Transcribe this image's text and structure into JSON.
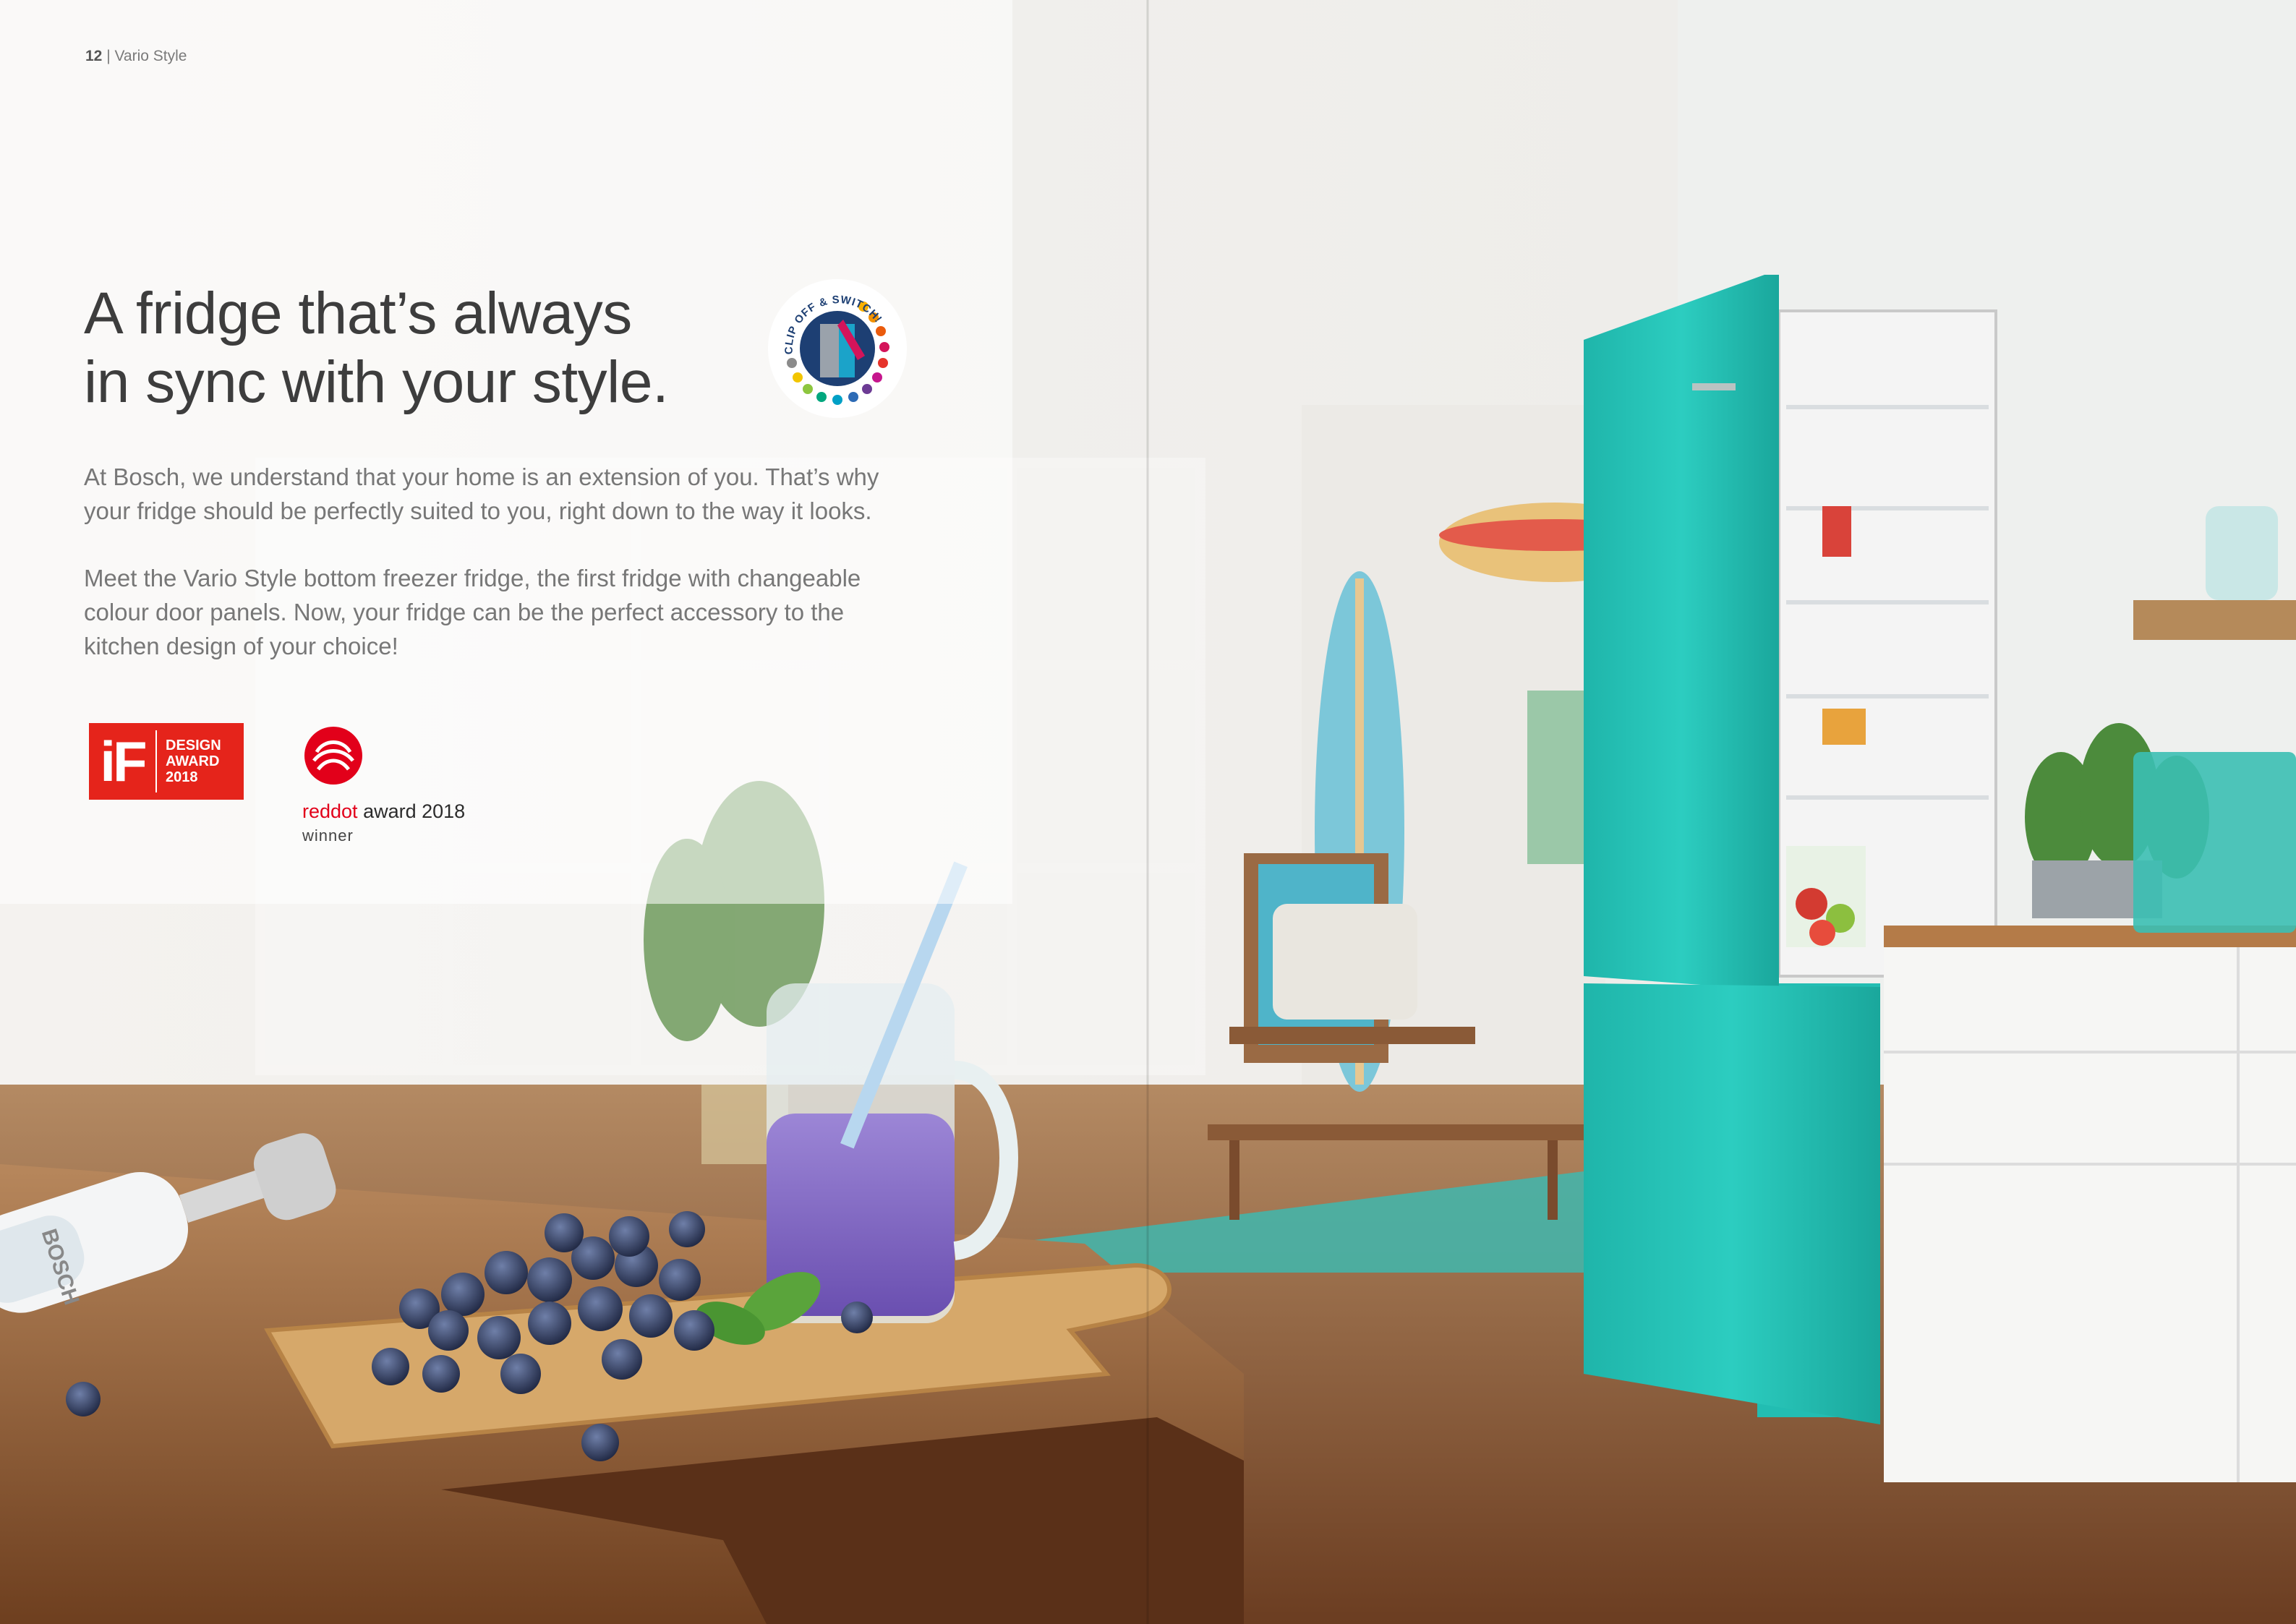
{
  "page": {
    "number": "12",
    "section": "Vario Style"
  },
  "headline": {
    "line1": "A fridge that’s always",
    "line2": "in sync with your style."
  },
  "body": {
    "p1_line1": "At Bosch, we understand that your home is an extension of you. That’s why",
    "p1_line2": "your fridge should be perfectly suited to you, right down to the way it looks.",
    "p2_line1": "Meet the Vario Style bottom freezer fridge, the first fridge with changeable",
    "p2_line2": "colour door panels. Now, your fridge can be the perfect accessory to the",
    "p2_line3": "kitchen design of your choice!"
  },
  "awards": {
    "if": {
      "logo": "iF",
      "line1": "DESIGN",
      "line2": "AWARD",
      "line3": "2018",
      "color": "#e5241b"
    },
    "reddot": {
      "red_word": "reddot",
      "rest": " award 2018",
      "winner": "winner",
      "color": "#e2001a"
    }
  },
  "badge": {
    "text": "CLIP OFF & SWITCH!",
    "color": "#1d3f73"
  },
  "photo": {
    "fridge_color": "#23c2b6",
    "floor_color": "#7b4a2a",
    "blender_brand": "BOSCH"
  }
}
